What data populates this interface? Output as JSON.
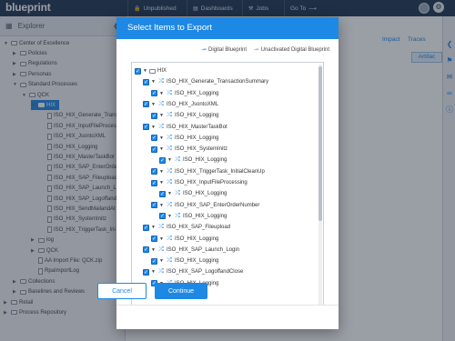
{
  "app": {
    "logo": "blueprint",
    "nav": [
      "Unpublished",
      "Dashboards",
      "Jobs",
      "Go To"
    ],
    "nav_icons": [
      "lock-icon",
      "chart-icon",
      "tools-icon",
      "arrow-right-icon"
    ]
  },
  "explorer": {
    "title": "Explorer",
    "items": [
      {
        "label": "Center of Excellence",
        "level": 0,
        "kind": "folder",
        "open": true
      },
      {
        "label": "Policies",
        "level": 1,
        "kind": "folder"
      },
      {
        "label": "Regulations",
        "level": 1,
        "kind": "folder"
      },
      {
        "label": "Personas",
        "level": 1,
        "kind": "folder"
      },
      {
        "label": "Standard Processes",
        "level": 1,
        "kind": "folder",
        "open": true
      },
      {
        "label": "QCK",
        "level": 2,
        "kind": "folder",
        "open": true
      },
      {
        "label": "HIX",
        "level": 3,
        "kind": "folder",
        "open": true,
        "selected": true
      },
      {
        "label": "ISO_HIX_Generate_Trans",
        "level": 4,
        "kind": "doc"
      },
      {
        "label": "ISO_HIX_InputFileProcess",
        "level": 4,
        "kind": "doc"
      },
      {
        "label": "ISO_HIX_JsontoXML",
        "level": 4,
        "kind": "doc"
      },
      {
        "label": "ISO_HIX_Logging",
        "level": 4,
        "kind": "doc"
      },
      {
        "label": "ISO_HIX_MasterTaskBot",
        "level": 4,
        "kind": "doc"
      },
      {
        "label": "ISO_HIX_SAP_EnterOrde",
        "level": 4,
        "kind": "doc"
      },
      {
        "label": "ISO_HIX_SAP_Fileupload",
        "level": 4,
        "kind": "doc"
      },
      {
        "label": "ISO_HIX_SAP_Launch_Lo",
        "level": 4,
        "kind": "doc"
      },
      {
        "label": "ISO_HIX_SAP_Logoffand",
        "level": 4,
        "kind": "doc"
      },
      {
        "label": "ISO_HIX_SendMailandAt",
        "level": 4,
        "kind": "doc"
      },
      {
        "label": "ISO_HIX_SystemInitz",
        "level": 4,
        "kind": "doc"
      },
      {
        "label": "ISO_HIX_TriggerTask_Ini",
        "level": 4,
        "kind": "doc"
      },
      {
        "label": "log",
        "level": 3,
        "kind": "folder"
      },
      {
        "label": "QCK",
        "level": 3,
        "kind": "folder"
      },
      {
        "label": "AA Import File: QCK.zip",
        "level": 3,
        "kind": "doc"
      },
      {
        "label": "RpaImportLog",
        "level": 3,
        "kind": "doc"
      },
      {
        "label": "Collections",
        "level": 1,
        "kind": "folder"
      },
      {
        "label": "Baselines and Reviews",
        "level": 1,
        "kind": "folder"
      },
      {
        "label": "Retail",
        "level": 0,
        "kind": "folder"
      },
      {
        "label": "Process Repository",
        "level": 0,
        "kind": "folder"
      }
    ]
  },
  "main": {
    "tabs": [
      "Impact",
      "Traces"
    ],
    "artifact_btn": "Artifac"
  },
  "modal": {
    "title": "Select Items to Export",
    "legend": [
      "Digital Blueprint",
      "Unactivated Digital Blueprint"
    ],
    "items": [
      {
        "label": "HIX",
        "level": 0,
        "kind": "folder"
      },
      {
        "label": "ISO_HIX_Generate_TransactionSummary",
        "level": 1,
        "kind": "bp"
      },
      {
        "label": "ISO_HIX_Logging",
        "level": 2,
        "kind": "bp"
      },
      {
        "label": "ISO_HIX_JsontoXML",
        "level": 1,
        "kind": "bp"
      },
      {
        "label": "ISO_HIX_Logging",
        "level": 2,
        "kind": "bp"
      },
      {
        "label": "ISO_HIX_MasterTaskBot",
        "level": 1,
        "kind": "bp"
      },
      {
        "label": "ISO_HIX_Logging",
        "level": 2,
        "kind": "bp"
      },
      {
        "label": "ISO_HIX_SystemInitz",
        "level": 2,
        "kind": "bp"
      },
      {
        "label": "ISO_HIX_Logging",
        "level": 3,
        "kind": "bp"
      },
      {
        "label": "ISO_HIX_TriggerTask_InitialCleanUp",
        "level": 2,
        "kind": "bp"
      },
      {
        "label": "ISO_HIX_InputFileProcessing",
        "level": 2,
        "kind": "bp"
      },
      {
        "label": "ISO_HIX_Logging",
        "level": 3,
        "kind": "bp"
      },
      {
        "label": "ISO_HIX_SAP_EnterOrderNumber",
        "level": 2,
        "kind": "bp"
      },
      {
        "label": "ISO_HIX_Logging",
        "level": 3,
        "kind": "bp"
      },
      {
        "label": "ISO_HIX_SAP_Fileupload",
        "level": 1,
        "kind": "bp"
      },
      {
        "label": "ISO_HIX_Logging",
        "level": 2,
        "kind": "bp"
      },
      {
        "label": "ISO_HIX_SAP_Launch_Login",
        "level": 1,
        "kind": "bp"
      },
      {
        "label": "ISO_HIX_Logging",
        "level": 2,
        "kind": "bp"
      },
      {
        "label": "ISO_HIX_SAP_LogoffandClose",
        "level": 1,
        "kind": "bp"
      },
      {
        "label": "ISO_HIX_Logging",
        "level": 2,
        "kind": "bp"
      }
    ],
    "cancel_label": "Cancel",
    "continue_label": "Continue",
    "accent_color": "#1e88e5"
  }
}
